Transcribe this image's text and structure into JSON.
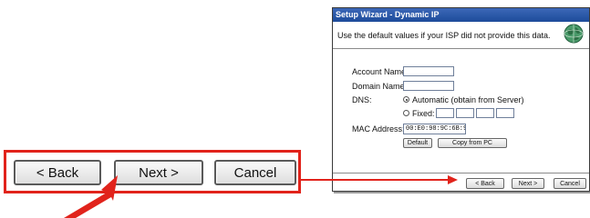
{
  "zoom": {
    "back_label": "< Back",
    "next_label": "Next >",
    "cancel_label": "Cancel"
  },
  "dialog": {
    "title": "Setup Wizard - Dynamic IP",
    "instruction": "Use the default values if your ISP did not provide this data.",
    "form": {
      "account_label": "Account Name:",
      "account_value": "",
      "domain_label": "Domain Name:",
      "domain_value": "",
      "dns_label": "DNS:",
      "dns_auto_label": "Automatic (obtain from Server)",
      "dns_fixed_label": "Fixed:",
      "dns_selected": "Automatic (obtain from Server)",
      "mac_label": "MAC Address:",
      "mac_value": "00:E0:98:9C:6B:9D",
      "default_label": "Default",
      "copy_label": "Copy from PC"
    },
    "footer": {
      "back_label": "< Back",
      "next_label": "Next >",
      "cancel_label": "Cancel"
    }
  },
  "colors": {
    "accent_red": "#e1231b",
    "title_blue": "#1d4b9a"
  },
  "icons": {
    "globe": "globe-icon",
    "pointer": "red-pointer-arrow",
    "connector": "connector-arrow"
  }
}
